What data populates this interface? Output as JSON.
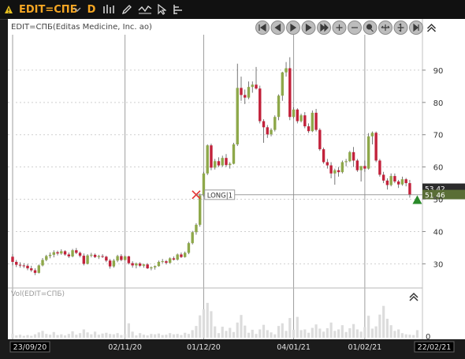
{
  "toolbar": {
    "instrument": "EDIT=СПБ",
    "period": "D",
    "icons": [
      "warning-icon",
      "chevron-down-icon",
      "bar-chart-icon",
      "pencil-icon",
      "chart-style-icon",
      "cursor-icon",
      "indicators-icon"
    ]
  },
  "colors": {
    "up": "#8ea84a",
    "down": "#c2223b",
    "long_marker": "#2a8a2a",
    "cross": "#e53030"
  },
  "nav_buttons": [
    "first-icon",
    "prev-icon",
    "play-icon",
    "next-icon",
    "last-icon",
    "zoom-in-icon",
    "zoom-out-icon",
    "zoom-fit-icon",
    "pan-horizontal-icon",
    "pan-vertical-icon",
    "step-end-icon",
    "collapse-icon"
  ],
  "chart_data": [
    {
      "type": "candlestick",
      "title": "EDIT=СПБ(Editas Medicine, Inc. ao)",
      "ylim": [
        23,
        100
      ],
      "yticks": [
        30,
        40,
        50,
        60,
        70,
        80,
        90
      ],
      "x_tick_labels": [
        "23/09/20",
        "02/11/20",
        "01/12/20",
        "04/01/21",
        "01/02/21",
        "22/02/21"
      ],
      "x_tick_index": [
        0,
        30,
        51,
        75,
        94,
        108
      ],
      "candles": [
        [
          32.2,
          33.0,
          29.5,
          30.6
        ],
        [
          30.6,
          31.2,
          29.0,
          29.7
        ],
        [
          29.7,
          30.5,
          28.8,
          29.5
        ],
        [
          29.5,
          30.2,
          28.7,
          29.4
        ],
        [
          29.4,
          30.0,
          28.0,
          28.6
        ],
        [
          28.6,
          29.4,
          27.5,
          28.0
        ],
        [
          28.0,
          28.6,
          26.5,
          27.2
        ],
        [
          27.2,
          29.8,
          27.0,
          29.5
        ],
        [
          29.5,
          31.8,
          29.2,
          31.2
        ],
        [
          31.2,
          32.8,
          30.8,
          32.4
        ],
        [
          32.4,
          33.5,
          31.7,
          32.8
        ],
        [
          32.8,
          34.2,
          32.0,
          33.6
        ],
        [
          33.6,
          34.1,
          32.6,
          33.2
        ],
        [
          33.2,
          34.5,
          32.8,
          33.9
        ],
        [
          33.9,
          34.2,
          32.5,
          32.9
        ],
        [
          32.9,
          33.5,
          31.8,
          32.3
        ],
        [
          32.3,
          34.6,
          32.0,
          34.2
        ],
        [
          34.2,
          34.9,
          33.0,
          33.4
        ],
        [
          33.4,
          33.8,
          32.0,
          32.5
        ],
        [
          32.5,
          33.2,
          29.5,
          30.0
        ],
        [
          30.0,
          33.0,
          29.8,
          32.6
        ],
        [
          32.6,
          33.4,
          32.0,
          32.8
        ],
        [
          32.8,
          33.2,
          31.8,
          32.1
        ],
        [
          32.1,
          32.8,
          31.5,
          32.4
        ],
        [
          32.4,
          33.0,
          31.8,
          32.2
        ],
        [
          32.2,
          32.5,
          30.5,
          31.0
        ],
        [
          31.0,
          31.5,
          28.5,
          29.2
        ],
        [
          29.2,
          31.5,
          28.8,
          31.0
        ],
        [
          31.0,
          32.8,
          30.5,
          32.4
        ],
        [
          32.4,
          33.0,
          30.8,
          31.2
        ],
        [
          31.2,
          32.6,
          31.0,
          32.3
        ],
        [
          32.3,
          32.5,
          29.8,
          30.2
        ],
        [
          30.2,
          30.8,
          28.8,
          29.5
        ],
        [
          29.5,
          30.4,
          28.6,
          30.1
        ],
        [
          30.1,
          30.5,
          29.0,
          29.4
        ],
        [
          29.4,
          30.0,
          28.8,
          29.8
        ],
        [
          29.8,
          30.2,
          28.4,
          28.6
        ],
        [
          28.6,
          29.2,
          28.0,
          28.9
        ],
        [
          28.9,
          29.5,
          28.2,
          29.3
        ],
        [
          29.3,
          31.0,
          29.1,
          30.6
        ],
        [
          30.6,
          31.5,
          30.2,
          30.8
        ],
        [
          30.8,
          31.2,
          29.8,
          30.3
        ],
        [
          30.3,
          32.0,
          30.1,
          31.7
        ],
        [
          31.7,
          32.3,
          31.0,
          31.3
        ],
        [
          31.3,
          33.2,
          31.0,
          32.9
        ],
        [
          32.9,
          33.5,
          31.8,
          32.1
        ],
        [
          32.1,
          33.8,
          31.9,
          33.4
        ],
        [
          33.4,
          36.8,
          33.0,
          36.4
        ],
        [
          36.4,
          40.2,
          36.0,
          39.8
        ],
        [
          39.8,
          42.6,
          39.0,
          42.1
        ],
        [
          42.1,
          51.8,
          41.5,
          51.2
        ],
        [
          51.2,
          58.5,
          50.8,
          58.0
        ],
        [
          58.0,
          67.0,
          57.5,
          66.7
        ],
        [
          66.7,
          67.2,
          59.0,
          59.8
        ],
        [
          59.8,
          62.5,
          59.2,
          61.8
        ],
        [
          61.8,
          63.0,
          60.0,
          60.5
        ],
        [
          60.5,
          63.5,
          60.0,
          62.8
        ],
        [
          62.8,
          64.0,
          60.0,
          60.6
        ],
        [
          60.6,
          61.5,
          59.5,
          61.0
        ],
        [
          61.0,
          67.5,
          60.8,
          67.0
        ],
        [
          67.0,
          92.0,
          66.5,
          84.5
        ],
        [
          84.5,
          88.0,
          80.5,
          82.3
        ],
        [
          82.3,
          84.0,
          79.5,
          81.5
        ],
        [
          81.5,
          86.5,
          81.0,
          84.8
        ],
        [
          84.8,
          86.5,
          83.0,
          85.5
        ],
        [
          85.5,
          91.0,
          84.0,
          84.3
        ],
        [
          84.3,
          85.2,
          73.5,
          74.2
        ],
        [
          74.2,
          74.8,
          67.5,
          72.3
        ],
        [
          72.3,
          73.0,
          69.0,
          70.1
        ],
        [
          70.1,
          72.0,
          69.5,
          71.5
        ],
        [
          71.5,
          76.0,
          71.0,
          75.5
        ],
        [
          75.5,
          82.5,
          74.5,
          82.1
        ],
        [
          82.1,
          89.5,
          80.5,
          89.3
        ],
        [
          89.3,
          92.5,
          88.0,
          90.6
        ],
        [
          90.6,
          94.0,
          74.5,
          75.5
        ],
        [
          75.5,
          78.5,
          75.0,
          77.8
        ],
        [
          77.8,
          78.2,
          73.5,
          74.2
        ],
        [
          74.2,
          76.5,
          73.8,
          76.0
        ],
        [
          76.0,
          77.0,
          72.0,
          72.6
        ],
        [
          72.6,
          73.5,
          70.5,
          71.1
        ],
        [
          71.1,
          77.5,
          70.8,
          76.8
        ],
        [
          76.8,
          78.0,
          71.0,
          71.5
        ],
        [
          71.5,
          72.0,
          65.0,
          65.5
        ],
        [
          65.5,
          66.0,
          61.0,
          61.5
        ],
        [
          61.5,
          62.5,
          59.5,
          60.5
        ],
        [
          60.5,
          61.5,
          56.5,
          58.0
        ],
        [
          58.0,
          59.5,
          54.5,
          59.0
        ],
        [
          59.0,
          60.0,
          57.0,
          58.4
        ],
        [
          58.4,
          62.0,
          58.0,
          61.5
        ],
        [
          61.5,
          62.5,
          60.2,
          61.8
        ],
        [
          61.8,
          65.0,
          61.5,
          64.6
        ],
        [
          64.6,
          66.2,
          60.0,
          62.0
        ],
        [
          62.0,
          62.5,
          58.5,
          59.0
        ],
        [
          59.0,
          59.5,
          55.5,
          60.3
        ],
        [
          60.3,
          62.0,
          58.5,
          59.5
        ],
        [
          59.5,
          70.5,
          59.2,
          69.5
        ],
        [
          69.5,
          71.0,
          67.0,
          70.6
        ],
        [
          70.6,
          71.0,
          61.5,
          62.0
        ],
        [
          62.0,
          62.5,
          57.0,
          57.6
        ],
        [
          57.6,
          58.5,
          55.0,
          55.8
        ],
        [
          55.8,
          56.5,
          53.0,
          54.4
        ],
        [
          54.4,
          58.0,
          54.0,
          57.2
        ],
        [
          57.2,
          58.0,
          55.0,
          55.5
        ],
        [
          55.5,
          56.0,
          53.5,
          54.6
        ],
        [
          54.6,
          57.0,
          54.2,
          56.2
        ],
        [
          56.2,
          56.6,
          54.0,
          55.0
        ],
        [
          55.0,
          56.0,
          50.5,
          51.4
        ]
      ],
      "annotations": [
        {
          "type": "cross",
          "index": 49,
          "price": 51.4
        },
        {
          "type": "label",
          "text": "LONG|1",
          "index": 50,
          "price": 51.4
        },
        {
          "type": "price_tag",
          "text": "53,42",
          "price": 53.42
        },
        {
          "type": "price_tag",
          "text": "51,46",
          "price": 51.46
        },
        {
          "type": "triangle_up",
          "index": 108,
          "price": 50.0
        }
      ]
    },
    {
      "type": "bar",
      "title": "Vol(EDIT=СПБ)",
      "ylim": [
        0,
        10
      ],
      "yticks": [
        0
      ],
      "volumes": [
        1.0,
        0.6,
        0.8,
        0.5,
        0.7,
        0.5,
        0.9,
        1.4,
        1.8,
        1.0,
        0.8,
        1.5,
        0.7,
        0.9,
        0.6,
        1.0,
        1.7,
        0.8,
        1.2,
        2.2,
        1.4,
        0.9,
        1.6,
        0.8,
        1.1,
        1.3,
        1.0,
        0.9,
        1.2,
        0.7,
        1.0,
        3.8,
        1.6,
        0.6,
        1.2,
        0.8,
        0.6,
        1.0,
        0.9,
        1.1,
        0.7,
        0.8,
        1.2,
        0.9,
        1.0,
        0.7,
        1.3,
        1.0,
        2.0,
        3.1,
        5.9,
        7.5,
        9.2,
        7.0,
        3.0,
        1.2,
        2.9,
        1.8,
        2.6,
        1.5,
        4.0,
        6.0,
        3.2,
        1.3,
        2.1,
        1.0,
        2.2,
        3.4,
        2.0,
        1.4,
        0.9,
        3.1,
        3.8,
        1.8,
        5.2,
        2.1,
        5.5,
        2.0,
        2.2,
        1.3,
        2.6,
        3.5,
        2.4,
        1.6,
        2.5,
        4.0,
        1.8,
        2.2,
        3.3,
        1.5,
        2.5,
        3.6,
        2.2,
        1.6,
        2.8,
        5.8,
        2.4,
        3.0,
        6.1,
        8.4,
        5.0,
        3.3,
        1.8,
        2.2,
        1.2,
        0.9,
        0.8,
        0.7,
        2.0
      ]
    }
  ]
}
